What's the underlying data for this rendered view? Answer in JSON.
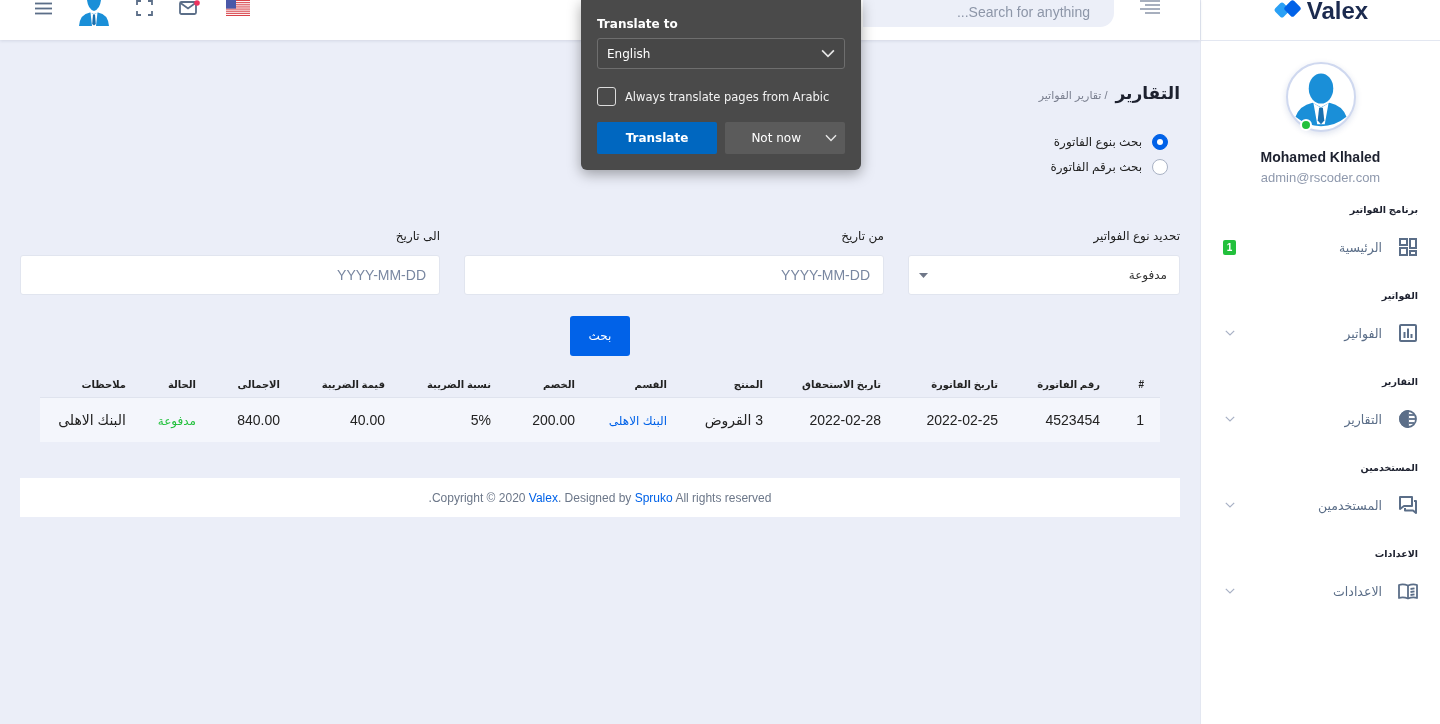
{
  "header": {
    "search": {
      "placeholder": "...Search for anything"
    }
  },
  "translate_popup": {
    "title": "Translate to",
    "language": "English",
    "always_translate": {
      "label": "Always translate pages from Arabic",
      "checked": false
    },
    "translate_button": "Translate",
    "not_now_button": "Not now"
  },
  "page": {
    "title": "التقارير",
    "breadcrumb": "/ تقارير الفواتير",
    "search_mode": [
      {
        "label": "بحث بنوع الفاتورة",
        "selected": true
      },
      {
        "label": "بحث برقم الفاتورة",
        "selected": false
      }
    ],
    "filters": [
      {
        "label": "تحديد نوع الفواتير",
        "kind": "select",
        "value": "مدفوعة"
      },
      {
        "label": "من تاريخ",
        "kind": "date",
        "placeholder": "YYYY-MM-DD"
      },
      {
        "label": "الى تاريخ",
        "kind": "date",
        "placeholder": "YYYY-MM-DD"
      }
    ],
    "search_button": "بحث",
    "table": {
      "columns": [
        "#",
        "رقم الفاتورة",
        "تاريخ الفاتورة",
        "تاريخ الاستحقاق",
        "المنتج",
        "القسم",
        "الخصم",
        "نسبة الضريبة",
        "قيمة الضريبة",
        "الاجمالى",
        "الحالة",
        "ملاحظات"
      ],
      "rows": [
        {
          "cells": [
            {
              "text": "1",
              "kind": "text"
            },
            {
              "text": "4523454",
              "kind": "text"
            },
            {
              "text": "2022-02-25",
              "kind": "text"
            },
            {
              "text": "2022-02-28",
              "kind": "text"
            },
            {
              "text": "3 القروض",
              "kind": "text"
            },
            {
              "text": "البنك الاهلى",
              "kind": "link"
            },
            {
              "text": "200.00",
              "kind": "text"
            },
            {
              "text": "5%",
              "kind": "text"
            },
            {
              "text": "40.00",
              "kind": "text"
            },
            {
              "text": "840.00",
              "kind": "text"
            },
            {
              "text": "مدفوعة",
              "kind": "status"
            },
            {
              "text": "البنك الاهلى",
              "kind": "text"
            }
          ]
        }
      ]
    }
  },
  "footer": {
    "text_start": ".Copyright © 2020 ",
    "brand_link": "Valex",
    "text_middle": ". Designed by ",
    "designer_link": "Spruko",
    "text_end": " All rights reserved"
  },
  "sidebar": {
    "logo": "Valex",
    "user": {
      "name": "Mohamed Klhaled",
      "email": "admin@rscoder.com",
      "online": true
    },
    "sections": [
      {
        "title": "برنامج الفواتير",
        "item": {
          "label": "الرئيسية",
          "badge": "1",
          "expandable": false
        }
      },
      {
        "title": "الفواتير",
        "item": {
          "label": "الفواتير",
          "expandable": true
        }
      },
      {
        "title": "التقارير",
        "item": {
          "label": "التقارير",
          "expandable": true
        }
      },
      {
        "title": "المستخدمين",
        "item": {
          "label": "المستخدمين",
          "expandable": true
        }
      },
      {
        "title": "الاعدادات",
        "item": {
          "label": "الاعدادات",
          "expandable": true
        }
      }
    ]
  }
}
